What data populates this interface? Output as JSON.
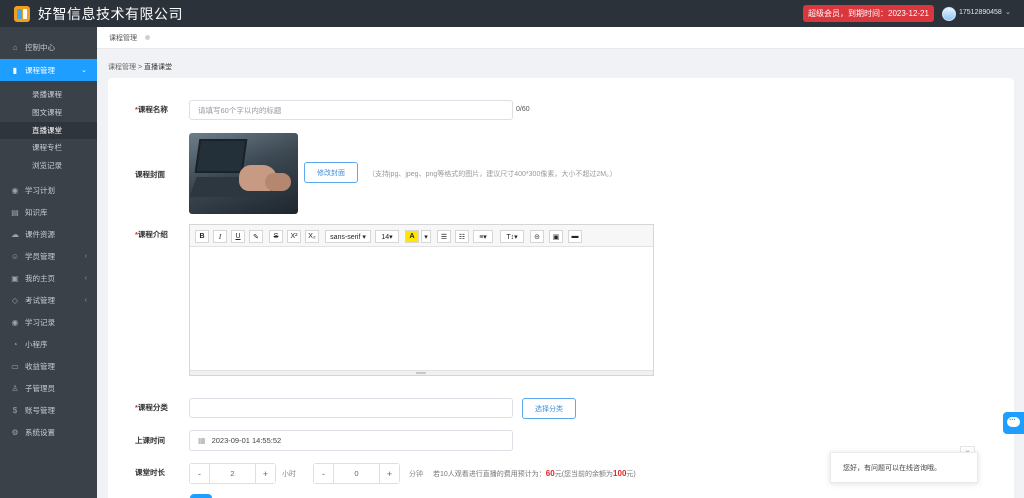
{
  "header": {
    "brand": "好智信息技术有限公司",
    "vip_badge": "超级会员，到期时间：2023-12-21",
    "user_phone": "17512890458"
  },
  "sidebar": {
    "items": [
      {
        "label": "控制中心",
        "icon": "home-icon"
      },
      {
        "label": "课程管理",
        "icon": "book-icon"
      },
      {
        "label": "学习计划",
        "icon": "eye-icon"
      },
      {
        "label": "知识库",
        "icon": "database-icon"
      },
      {
        "label": "课件资源",
        "icon": "cloud-icon"
      },
      {
        "label": "学员管理",
        "icon": "users-icon"
      },
      {
        "label": "我的主页",
        "icon": "homepage-icon"
      },
      {
        "label": "考试管理",
        "icon": "tag-icon"
      },
      {
        "label": "学习记录",
        "icon": "eye-icon"
      },
      {
        "label": "小程序",
        "icon": "chat-icon"
      },
      {
        "label": "收益管理",
        "icon": "card-icon"
      },
      {
        "label": "子管理员",
        "icon": "user-icon"
      },
      {
        "label": "账号管理",
        "icon": "dollar-icon"
      },
      {
        "label": "系统设置",
        "icon": "gear-icon"
      }
    ],
    "sub_items": [
      "录播课程",
      "图文课程",
      "直播课堂",
      "课程专栏",
      "浏览记录"
    ]
  },
  "tabs": {
    "active": "课程管理"
  },
  "breadcrumb": {
    "parent": "课程管理",
    "sep": ">",
    "current": "直播课堂"
  },
  "form": {
    "name_label": "课程名称",
    "name_placeholder": "请填写60个字以内的标题",
    "name_counter": "0/60",
    "cover_label": "课程封面",
    "cover_button": "修改封面",
    "cover_hint": "（支持jpg、jpeg、png等格式的图片，建议尺寸400*300像素，大小不超过2M。）",
    "intro_label": "课程介绍",
    "toolbar": {
      "bold": "B",
      "italic": "I",
      "underline": "U",
      "eraser": "✎",
      "strike": "S",
      "sup": "X²",
      "sub": "X₂",
      "font": "sans-serif ▾",
      "size": "14▾",
      "color": "A",
      "color_caret": "▾",
      "ul": "☰",
      "ol": "☷",
      "align": "≡▾",
      "heading": "T↕▾",
      "link": "⊝",
      "image": "▣",
      "video": "▬"
    },
    "category_label": "课程分类",
    "category_button": "选择分类",
    "time_label": "上课时间",
    "time_value": "2023-09-01 14:55:52",
    "duration_label": "课堂时长",
    "hours_value": "2",
    "hours_unit": "小时",
    "minutes_value": "0",
    "minutes_unit": "分钟",
    "cost_note_prefix": "若10人观看进行直播的费用预计为：",
    "cost_value": "60",
    "cost_note_mid": "元(您当前的余额为",
    "balance_value": "100",
    "cost_note_suffix": "元)",
    "stepper_minus": "-",
    "stepper_plus": "+"
  },
  "chat": {
    "message": "您好，有问题可以在线咨询哦。",
    "close": "×"
  },
  "colors": {
    "topbar": "#2b323a",
    "sidebar": "#3a4149",
    "accent": "#1e9fff",
    "danger": "#d9363e"
  }
}
